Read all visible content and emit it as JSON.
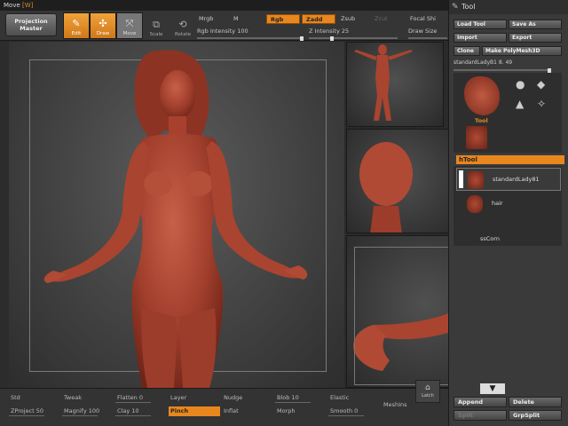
{
  "title": {
    "tool_name": "Move",
    "hotkey": "[W]"
  },
  "toolbar": {
    "projection_master": "Projection Master",
    "edit": "Edit",
    "draw": "Draw",
    "move": "Move",
    "scale": "Scale",
    "rotate": "Rotate",
    "mrgb": "Mrgb",
    "m": "M",
    "rgb": "Rgb",
    "zadd": "Zadd",
    "zsub": "Zsub",
    "zcut": "Zcut",
    "focal_shift": "Focal Shi",
    "draw_size": "Draw Size",
    "rgb_intensity_label": "Rgb Intensity",
    "rgb_intensity_value": "100",
    "z_intensity_label": "Z Intensity",
    "z_intensity_value": "25"
  },
  "palette": {
    "header": "Tool",
    "load_tool": "Load Tool",
    "save_as": "Save As",
    "import": "Import",
    "export": "Export",
    "clone": "Clone",
    "make_polymesh": "Make PolyMesh3D",
    "current_tool": "standardLadyB1",
    "current_value": "8. 49",
    "tool_thumb_label": "Tool",
    "subtool_header": "hTool",
    "subtools": [
      "standardLady81",
      "hair",
      "ssCorn"
    ]
  },
  "brushes": {
    "row1": [
      "Std",
      "Tweak",
      "Flatten",
      "Layer",
      "Nudge",
      "Blob",
      "Elastic"
    ],
    "row1_values": {
      "Flatten": "0",
      "Blob": "10"
    },
    "row2": [
      "ZProject",
      "Magnify",
      "Clay",
      "Pinch",
      "Inflat",
      "Morph",
      "Smooth"
    ],
    "row2_values": {
      "ZProject": "50",
      "Magnify": "100",
      "Clay": "10",
      "Smooth": "0"
    },
    "selected": "Pinch",
    "meshins": "MeshIns",
    "latch": "Latch"
  },
  "lower_right": {
    "append": "Append",
    "delete": "Delete",
    "grpsplit": "GrpSplit",
    "split": "Split",
    "arrow_down": "▼"
  },
  "colors": {
    "accent": "#e8871e",
    "skin": "#b24a36",
    "panel": "#3a3a3a"
  }
}
